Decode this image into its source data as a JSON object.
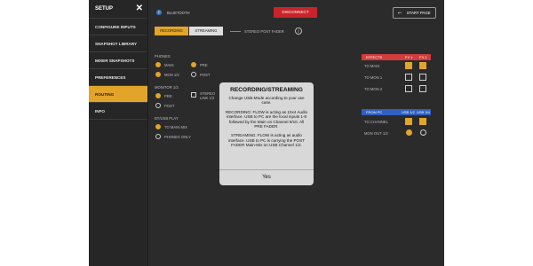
{
  "sidebar": {
    "title": "SETUP",
    "items": [
      {
        "label": "CONFIGURE INPUTS",
        "active": false
      },
      {
        "label": "SNAPSHOT LIBRARY",
        "active": false
      },
      {
        "label": "MIXER SNAPSHOTS",
        "active": false
      },
      {
        "label": "PREFERENCES",
        "active": false
      },
      {
        "label": "ROUTING",
        "active": true
      },
      {
        "label": "INFO",
        "active": false
      }
    ]
  },
  "header": {
    "bluetooth_label": "BLUETOOTH",
    "disconnect_label": "DISCONNECT",
    "start_page_label": "START PAGE"
  },
  "tabs": {
    "recording": "RECORDING",
    "streaming": "STREAMING",
    "stereo_post_fader": "STEREO POST FADER",
    "info_glyph": "i"
  },
  "phones": {
    "label": "PHONES",
    "main": "MAIN",
    "mon12": "MON 1/2",
    "pre": "PRE",
    "post": "POST"
  },
  "monitor": {
    "label": "MONITOR 1/2",
    "pre": "PRE",
    "post": "POST",
    "stereo_link": "STEREO LINK 1/2"
  },
  "bt_usb": {
    "label": "BT/USB PLAY",
    "to_main_mix": "TO MAIN MIX",
    "phones_only": "PHONES ONLY"
  },
  "effects": {
    "header": "EFFECTS",
    "fx1": "FX 1",
    "fx2": "FX 2",
    "rows": [
      {
        "label": "TO MAIN",
        "fx1": true,
        "fx2": true
      },
      {
        "label": "TO MON 1",
        "fx1": false,
        "fx2": false
      },
      {
        "label": "TO MON 2",
        "fx1": false,
        "fx2": false
      }
    ]
  },
  "from_pc": {
    "header": "FROM PC",
    "usb12": "USB 1/2",
    "usb34": "USB 3/4",
    "rows": [
      {
        "label": "TO CHANNEL"
      },
      {
        "label": "MON OUT 1/2"
      }
    ]
  },
  "dialog": {
    "title": "RECORDING/STREAMING",
    "intro": "Change USB-Mode according to your use case.",
    "recording_text": "RECORDING: FLOW is acting as 10x4 Audio interface. USB to PC are the local inputs 1-8 followed by the Main on Channel 9/10. All PRE FADER.",
    "streaming_text": "STREAMING: FLOW is acting as audio interface. USB to PC is carrying the POST FADER Main-Mix on USB Channel 1/2.",
    "yes_label": "Yes"
  },
  "colors": {
    "accent": "#e2a52a",
    "disconnect": "#c8242a",
    "effects_header": "#d13c3c",
    "from_pc_header": "#2f5fbf",
    "bluetooth": "#3a78c8"
  }
}
